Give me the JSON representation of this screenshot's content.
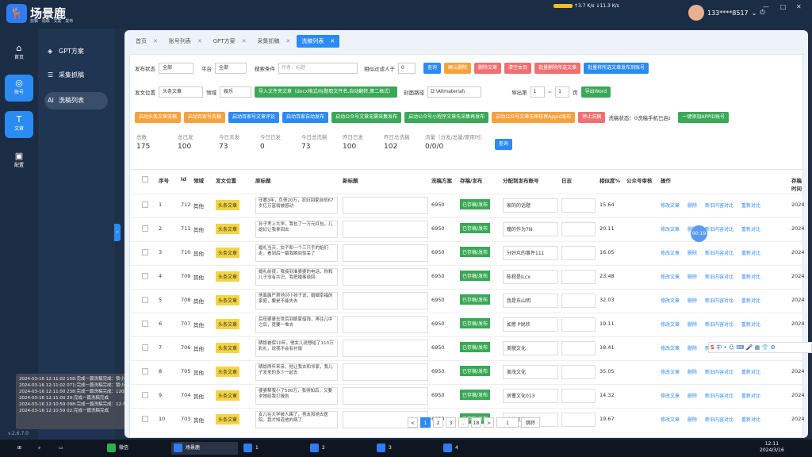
{
  "app": {
    "logo_glyph": "🦌",
    "name": "场景鹿",
    "tagline": "剪辑 · 追踪 · 文案 · 发布",
    "version": "v.2.6.7.0"
  },
  "net": {
    "up": "3.7",
    "up_unit": "K/s",
    "down": "11.3",
    "down_unit": "K/s"
  },
  "user": {
    "phone": "133****8517",
    "chevron": "⌄",
    "power_icon": "power-icon"
  },
  "window_controls": [
    "—",
    "□",
    "✕"
  ],
  "sidebar": [
    {
      "icon": "home-icon",
      "glyph": "⌂",
      "label": "首页"
    },
    {
      "icon": "user-icon",
      "glyph": "◎",
      "label": "账号"
    },
    {
      "icon": "text-icon",
      "glyph": "T",
      "label": "文章"
    },
    {
      "icon": "config-icon",
      "glyph": "▣",
      "label": "配置"
    }
  ],
  "subnav": [
    {
      "icon": "gpt-icon",
      "glyph": "◈",
      "label": "GPT方案"
    },
    {
      "icon": "list-icon",
      "glyph": "☰",
      "label": "采集抓稿"
    },
    {
      "icon": "ai-icon",
      "glyph": "AI",
      "label": "洗稿列表"
    }
  ],
  "tabs": [
    {
      "label": "首页"
    },
    {
      "label": "账号列表"
    },
    {
      "label": "GPT方案"
    },
    {
      "label": "采集抓稿"
    },
    {
      "label": "洗稿列表"
    }
  ],
  "filters": {
    "row1": {
      "status_label": "发布状态",
      "status_value": "全部",
      "platform_label": "平台",
      "platform_value": "全部",
      "search_label": "搜索条件",
      "search_placeholder": "作者、标题",
      "limit_label": "相似过滤人于",
      "limit_value": "0",
      "buttons": [
        "查询",
        "确认删除",
        "删除文章",
        "清空本页",
        "批量删除所选文章",
        "批量删除所选文章到同一个账号",
        "批量将所选文章发布到账号"
      ]
    },
    "row2": {
      "position_label": "发文位置",
      "position_value": "头条文章",
      "field_label": "领域",
      "field_value": "娱乐",
      "import_btn": "导入文件夹文章（docx格式/标题取文件名,自动翻转,第二格式）",
      "path_label": "封面路径",
      "path_value": "D:\\Allmaterial\\",
      "export_label": "导出第",
      "page_from": "1",
      "page_sep": "~",
      "page_to": "1",
      "page_unit": "页",
      "export_btn": "导出Word"
    },
    "row3": {
      "buttons": [
        "启动头条文章洗稿",
        "启动百家号洗稿",
        "启动百家号文章评论",
        "启动百家自动发布",
        "启动公众号文章无需采集发布",
        "启动公众号小程序文章先采集再发布",
        "启动公众号文章先审核再Appid发布"
      ],
      "stop_btn": "停止洗稿",
      "status_text": "洗稿状态：0洗稿手机已启动...",
      "wechat_btn": "一键添加APPID账号"
    }
  },
  "stats": [
    {
      "label": "总数",
      "value": "175"
    },
    {
      "label": "总已发",
      "value": "100"
    },
    {
      "label": "今日未发",
      "value": "73"
    },
    {
      "label": "今日已发",
      "value": "0"
    },
    {
      "label": "今日总洗稿",
      "value": "73"
    },
    {
      "label": "昨日已发",
      "value": "100"
    },
    {
      "label": "昨日总洗稿",
      "value": "102"
    },
    {
      "label": "流量（分发/总量/原用时）",
      "value": "0/0/0"
    }
  ],
  "stats_btn": "查询",
  "table": {
    "headers": [
      "序号",
      "Id",
      "领域",
      "发文位置",
      "原标题",
      "新标题",
      "洗稿方案",
      "存稿/发布",
      "分配到发布账号",
      "日志",
      "相似度%",
      "公众号审核",
      "操作",
      "存稿时间"
    ],
    "ops": [
      "修改文章",
      "删除",
      "新旧内容对比",
      "重新对比"
    ],
    "rows": [
      {
        "n": "1",
        "id": "712",
        "field": "其他",
        "pos": "头条文章",
        "title": "守寡3年，负债20万，农妇回家自创67岁亿万富翁被感动",
        "scheme": "6950",
        "status": "已存稿/发布",
        "acc": "家的的话题",
        "sim": "15.64",
        "date": "2024"
      },
      {
        "n": "2",
        "id": "711",
        "field": "其他",
        "pos": "头条文章",
        "title": "孙子考上大学，我包了一万元红包，儿媳妇让我拿回去",
        "scheme": "6950",
        "status": "已存稿/发布",
        "acc": "瞳的作为7N",
        "sim": "20.11",
        "date": "2024"
      },
      {
        "n": "3",
        "id": "710",
        "field": "其他",
        "pos": "头条文章",
        "title": "婚礼当天，女子和一个三只手的姐们走，看到后一幕我瞬间惊呆了",
        "scheme": "6950",
        "status": "已存稿/发布",
        "acc": "分好众的事件111",
        "sim": "16.05",
        "date": "2024"
      },
      {
        "n": "4",
        "id": "709",
        "field": "其他",
        "pos": "头条文章",
        "title": "婚礼前夜，我接到准婆婆的电话，你和儿子没有共识，我把婚事退回",
        "scheme": "6950",
        "status": "已存稿/发布",
        "acc": "陈程是iLcx",
        "sim": "23.48",
        "date": "2024"
      },
      {
        "n": "5",
        "id": "708",
        "field": "其他",
        "pos": "头条文章",
        "title": "他面露严肃地对小孩子说，婚姻幸福的家庭，要是不能失去",
        "scheme": "6950",
        "status": "已存稿/发布",
        "acc": "我是东山明",
        "sim": "32.03",
        "date": "2024"
      },
      {
        "n": "6",
        "id": "707",
        "field": "其他",
        "pos": "头条文章",
        "title": "后母婆婆去世后到娘家借钱，再往儿中之后，竟要一堆去",
        "scheme": "6950",
        "status": "已存稿/发布",
        "acc": "如意 P锐欣",
        "sim": "19.11",
        "date": "2024"
      },
      {
        "n": "7",
        "id": "706",
        "field": "其他",
        "pos": "头条文章",
        "title": "晒饭被保10年，他女儿说想给了110万彩礼，说我不会有补偿",
        "scheme": "6950",
        "status": "已存稿/发布",
        "acc": "美貌文化",
        "sim": "18.41",
        "date": "2024"
      },
      {
        "n": "8",
        "id": "705",
        "field": "其他",
        "pos": "头条文章",
        "title": "晒饭两年来亲，他让我去和邻家，我儿子发来的多少一起去",
        "scheme": "6950",
        "status": "已存稿/发布",
        "acc": "美茂文化",
        "sim": "35.05",
        "date": "2024"
      },
      {
        "n": "9",
        "id": "704",
        "field": "其他",
        "pos": "头条文章",
        "title": "婆婆帮我小了500万，我得知后，又要求她给我打报告",
        "scheme": "6950",
        "status": "已存稿/发布",
        "acc": "房董文化013",
        "sim": "14.32",
        "date": "2024"
      },
      {
        "n": "10",
        "id": "703",
        "field": "其他",
        "pos": "头条文章",
        "title": "女儿在大学被人踢了，男友和她去医院，我才知道他的病了",
        "scheme": "6950",
        "status": "已存稿/发布",
        "acc": "隆某文化",
        "sim": "19.67",
        "date": "2024"
      }
    ]
  },
  "pager": {
    "pages": [
      "1",
      "2",
      "3",
      "...",
      "18"
    ],
    "prev": "<",
    "next": ">",
    "goto": "1",
    "jump": "跳转"
  },
  "float_timer": "00:19",
  "logs": [
    "2024-03-16 12:11:02 158:完成一篇洗稿完成：锁小·天大",
    "2024-03-16 12:11:02 071:完成一篇洗稿完成：锁小·天大",
    "2024-03-16 12:11:00 238:完成一篇洗稿完成：1203--我",
    "2024-03-16 12:11:00 29:完成一篇洗稿完成",
    "2024-03-16 12:10:59 098:完成一篇洗稿完成：12·与",
    "2024-03-16 12:10:59 02:完成一篇洗稿完成"
  ],
  "ime": {
    "logo": "S",
    "mode": "中",
    "items": "• ☺ ⌨ 🎤 ▦ 👕 ⚙"
  },
  "taskbar": {
    "items": [
      {
        "label": "微信",
        "color": "#2bb24c"
      },
      {
        "label": "场景鹿",
        "color": "#2f7cf5"
      },
      {
        "label": "1",
        "color": "#2f7cf5"
      },
      {
        "label": "2",
        "color": "#2f7cf5"
      },
      {
        "label": "3",
        "color": "#2f7cf5"
      },
      {
        "label": "4",
        "color": "#2f7cf5"
      }
    ],
    "time": "12:11",
    "date": "2024/3/16"
  }
}
